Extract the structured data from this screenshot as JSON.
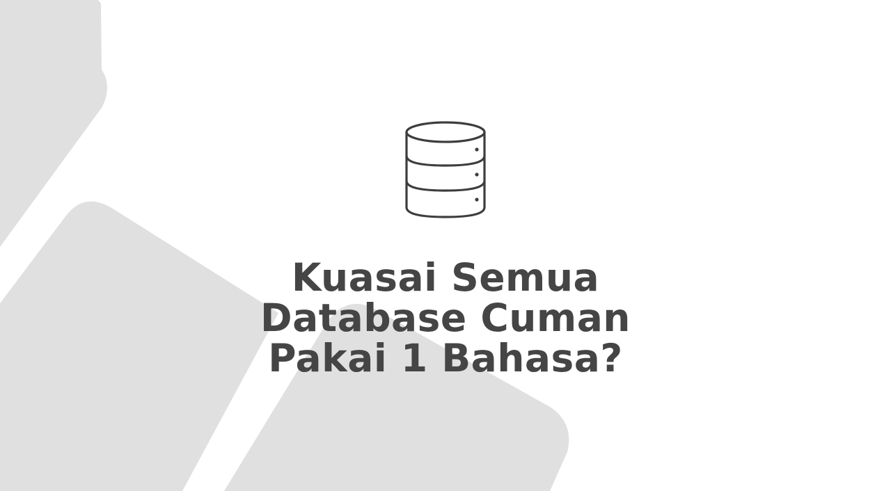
{
  "background": {
    "color": "#ffffff",
    "shape_color": "#e0e0e0"
  },
  "icon": {
    "name": "database-icon",
    "stroke_color": "#3d3d3d"
  },
  "headline": {
    "lines": [
      "Kuasai Semua",
      "Database Cuman",
      "Pakai 1 Bahasa?"
    ],
    "color": "#454545"
  }
}
